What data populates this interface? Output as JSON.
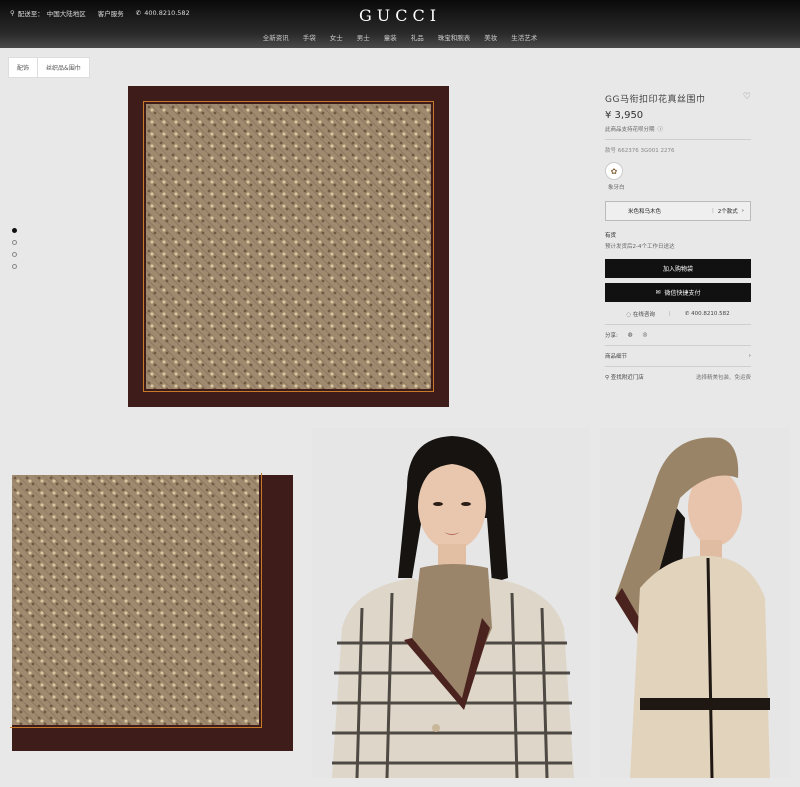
{
  "header": {
    "ship_to": "配送至：",
    "region": "中国大陆地区",
    "service": "客户服务",
    "phone": "400.8210.582",
    "logo": "GUCCI",
    "nav": [
      "全新资讯",
      "手袋",
      "女士",
      "男士",
      "童装",
      "礼品",
      "珠宝和腕表",
      "美妆",
      "生活艺术"
    ]
  },
  "breadcrumb": [
    "配饰",
    "丝织品&围巾"
  ],
  "carousel": {
    "count": 4,
    "active": 0
  },
  "product": {
    "title": "GG马衔扣印花真丝围巾",
    "price": "¥ 3,950",
    "payment_note": "此商品支持花呗分期",
    "style_no": "款号 662376 3G001 2276",
    "color_label": "象牙白",
    "size_label": "米色和乌木色",
    "size_count": "2个款式",
    "availability_title": "有货",
    "availability_note": "预计发货后2-4个工作日送达",
    "add_to_bag": "加入购物袋",
    "wechat_pay": "微信快捷支付",
    "online_consult": "在线咨询",
    "phone": "400.8210.582",
    "share_label": "分享:",
    "details_label": "商品细节",
    "store_label": "查找附近门店",
    "delivery_note": "选择精美包装、免运费"
  },
  "colors": {
    "header_bg": "#1a1a1a",
    "scarf_border": "#3d1c1a",
    "scarf_field": "#a08a6f",
    "scarf_stripe": "#c77b2a",
    "button_bg": "#111111"
  }
}
